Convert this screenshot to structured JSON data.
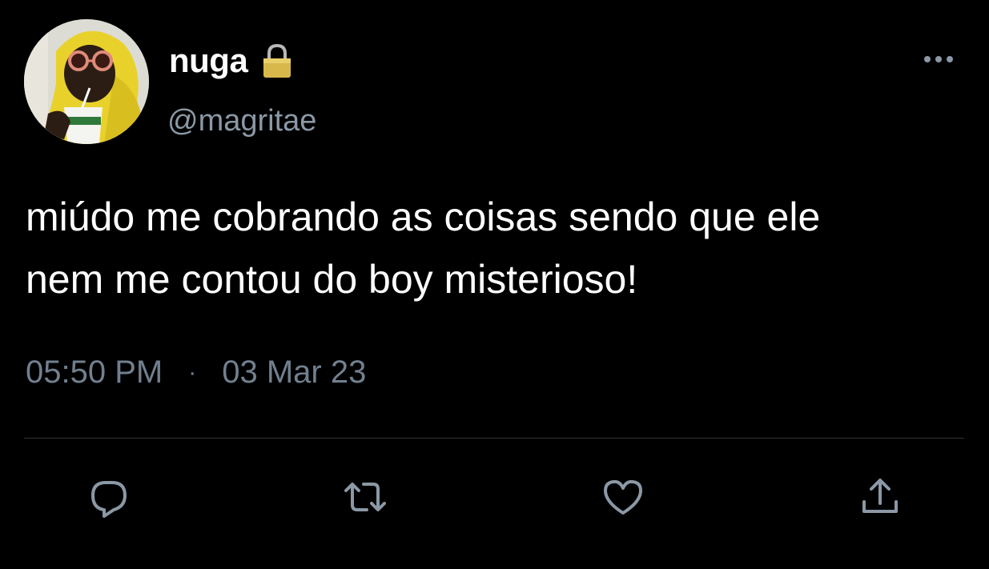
{
  "tweet": {
    "author": {
      "display_name": "nuga",
      "handle": "@magritae",
      "avatar_icon": "avatar-photo",
      "protected_icon": "lock-icon"
    },
    "text_lines": [
      "miúdo me cobrando as coisas sendo que ele",
      "nem me contou do boy misterioso!"
    ],
    "time": "05:50 PM",
    "separator": "·",
    "date": "03 Mar 23",
    "more_icon": "more-icon",
    "actions": [
      {
        "icon": "reply-icon"
      },
      {
        "icon": "retweet-icon"
      },
      {
        "icon": "like-icon"
      },
      {
        "icon": "share-icon"
      }
    ]
  },
  "colors": {
    "background": "#000000",
    "text": "#ffffff",
    "secondary": "#8b98a5",
    "icon": "#8b98a5",
    "divider": "#2f3336"
  }
}
